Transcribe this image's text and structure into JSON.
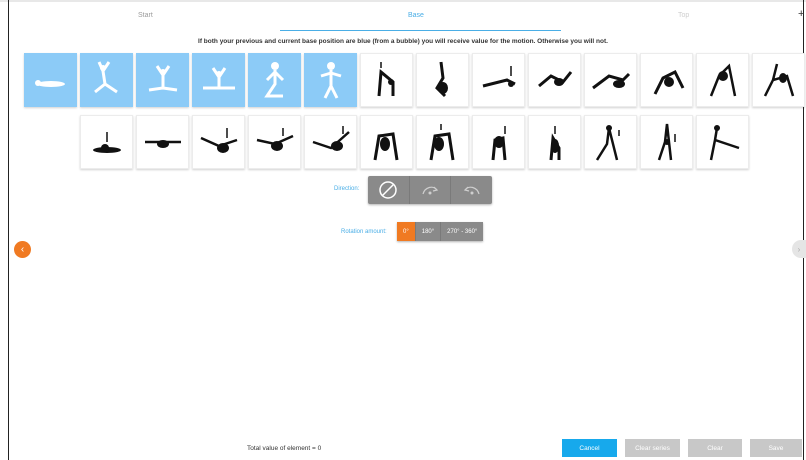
{
  "tabs": {
    "start": "Start",
    "base": "Base",
    "top": "Top",
    "plus": "+"
  },
  "instruction": "If both your previous and current base position are blue (from a bubble) you will receive value for the motion. Otherwise you will not.",
  "direction": {
    "label": "Direction:",
    "options": [
      "none",
      "forward",
      "backward"
    ]
  },
  "rotation": {
    "label": "Rotation amount:",
    "options": [
      "0°",
      "180°",
      "270° - 360°"
    ],
    "selected": "0°"
  },
  "nav": {
    "prev": "‹",
    "next": "›"
  },
  "footer": {
    "total": "Total value of element = 0",
    "cancel": "Cancel",
    "clear_series": "Clear series",
    "clear": "Clear",
    "save": "Save"
  },
  "colors": {
    "accent_blue": "#4aaee6",
    "card_blue": "#8ccbf7",
    "orange": "#f07a22",
    "button_blue": "#17a9ec",
    "gray": "#8a8a8a"
  },
  "positions_row1": [
    {
      "name": "lying-flat",
      "selected": true
    },
    {
      "name": "kneel-arms-up",
      "selected": true
    },
    {
      "name": "sit-arms-up",
      "selected": true
    },
    {
      "name": "straddle-sit",
      "selected": true
    },
    {
      "name": "kneel-upright",
      "selected": true
    },
    {
      "name": "stand-arms-out",
      "selected": true
    },
    {
      "name": "forward-fold",
      "selected": false
    },
    {
      "name": "shoulder-stand",
      "selected": false
    },
    {
      "name": "plank",
      "selected": false
    },
    {
      "name": "seated-back-arch",
      "selected": false
    },
    {
      "name": "plow",
      "selected": false
    },
    {
      "name": "side-lunge",
      "selected": false
    },
    {
      "name": "back-walkover",
      "selected": false
    },
    {
      "name": "bridge-leg-up",
      "selected": false
    }
  ],
  "positions_row2": [
    {
      "name": "lying-prone",
      "selected": false
    },
    {
      "name": "split-lying",
      "selected": false
    },
    {
      "name": "split-arch",
      "selected": false
    },
    {
      "name": "split-reach",
      "selected": false
    },
    {
      "name": "split-lean",
      "selected": false
    },
    {
      "name": "bridge",
      "selected": false
    },
    {
      "name": "bridge-arm",
      "selected": false
    },
    {
      "name": "squat-arch",
      "selected": false
    },
    {
      "name": "stand-bend",
      "selected": false
    },
    {
      "name": "lunge-reach",
      "selected": false
    },
    {
      "name": "lunge-stand",
      "selected": false
    },
    {
      "name": "standing-split",
      "selected": false
    }
  ]
}
